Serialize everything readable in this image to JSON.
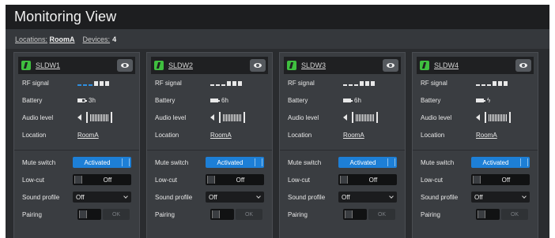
{
  "header": {
    "title": "Monitoring View"
  },
  "breadcrumb": {
    "locations_label": "Locations:",
    "locations_value": "RoomA",
    "devices_label": "Devices:",
    "devices_value": "4"
  },
  "labels": {
    "rf_signal": "RF signal",
    "battery": "Battery",
    "audio_level": "Audio level",
    "location": "Location",
    "mute_switch": "Mute switch",
    "low_cut": "Low-cut",
    "sound_profile": "Sound profile",
    "pairing": "Pairing"
  },
  "devices": [
    {
      "name": "SLDW1",
      "battery": "3h",
      "location": "RoomA",
      "mute": "Activated",
      "lowcut": "Off",
      "profile": "Off",
      "pair_btn": "OK",
      "rf_bars": 6,
      "rf_lit_blue": 3
    },
    {
      "name": "SLDW2",
      "battery": "6h",
      "location": "RoomA",
      "mute": "Activated",
      "lowcut": "Off",
      "profile": "Off",
      "pair_btn": "OK",
      "rf_bars": 6,
      "rf_lit_blue": 0
    },
    {
      "name": "SLDW3",
      "battery": "6h",
      "location": "RoomA",
      "mute": "Activated",
      "lowcut": "Off",
      "profile": "Off",
      "pair_btn": "OK",
      "rf_bars": 6,
      "rf_lit_blue": 0
    },
    {
      "name": "SLDW4",
      "battery": "",
      "battery_icon": "charging-icon",
      "location": "RoomA",
      "mute": "Activated",
      "lowcut": "Off",
      "profile": "Off",
      "pair_btn": "OK",
      "rf_bars": 6,
      "rf_lit_blue": 0
    }
  ],
  "colors": {
    "accent": "#1d7fd6",
    "status_ok": "#3fbf3f"
  }
}
